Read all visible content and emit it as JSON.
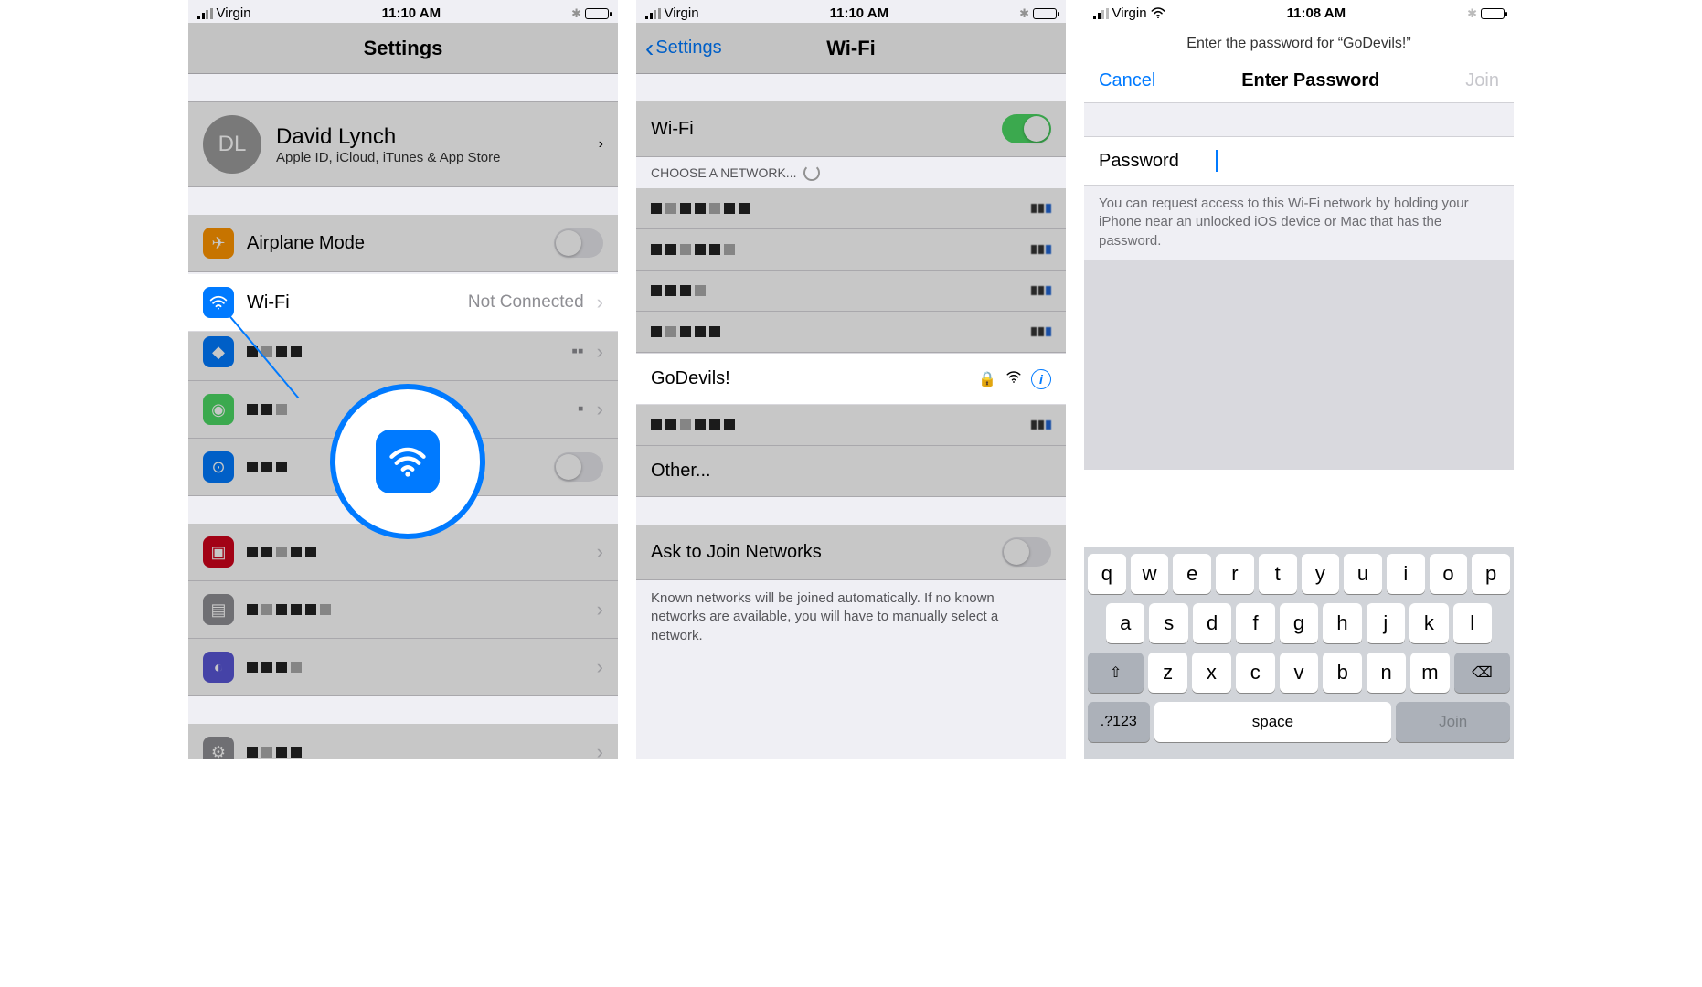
{
  "screen1": {
    "status": {
      "carrier": "Virgin",
      "time": "11:10 AM"
    },
    "title": "Settings",
    "profile": {
      "initials": "DL",
      "name": "David Lynch",
      "sub": "Apple ID, iCloud, iTunes & App Store"
    },
    "airplane": "Airplane Mode",
    "wifi": {
      "label": "Wi-Fi",
      "value": "Not Connected"
    }
  },
  "screen2": {
    "status": {
      "carrier": "Virgin",
      "time": "11:10 AM"
    },
    "back": "Settings",
    "title": "Wi-Fi",
    "wifi_label": "Wi-Fi",
    "choose": "CHOOSE A NETWORK...",
    "highlight_network": "GoDevils!",
    "other": "Other...",
    "ask": "Ask to Join Networks",
    "footer": "Known networks will be joined automatically. If no known networks are available, you will have to manually select a network."
  },
  "screen3": {
    "status": {
      "carrier": "Virgin",
      "time": "11:08 AM"
    },
    "prompt": "Enter the password for “GoDevils!”",
    "cancel": "Cancel",
    "title": "Enter Password",
    "join": "Join",
    "pw_label": "Password",
    "help": "You can request access to this Wi-Fi network by holding your iPhone near an unlocked iOS device or Mac that has the password.",
    "kb": {
      "row1": [
        "q",
        "w",
        "e",
        "r",
        "t",
        "y",
        "u",
        "i",
        "o",
        "p"
      ],
      "row2": [
        "a",
        "s",
        "d",
        "f",
        "g",
        "h",
        "j",
        "k",
        "l"
      ],
      "row3": [
        "z",
        "x",
        "c",
        "v",
        "b",
        "n",
        "m"
      ],
      "numkey": ".?123",
      "space": "space",
      "joinkey": "Join"
    }
  }
}
